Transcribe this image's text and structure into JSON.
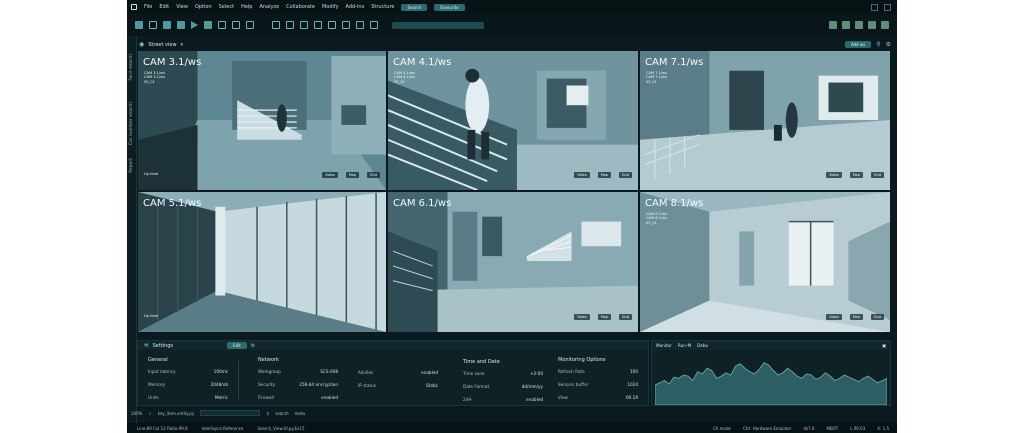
{
  "menu": [
    "File",
    "Edit",
    "View",
    "Option",
    "Select",
    "Help",
    "Analyze",
    "Collaborate",
    "Modify",
    "Add-ins",
    "Structure"
  ],
  "menu_pills": [
    "Search",
    "Favourite"
  ],
  "view_title": "Street view",
  "add_button": "Add ws",
  "sidebar_tabs": [
    "Face search",
    "Car number search",
    "Report"
  ],
  "cameras": [
    {
      "title": "CAM 3.1/ws",
      "info": [
        "CAM 3.1/ws",
        "CAM 3.1/ws",
        "05_01"
      ],
      "live": "Up time",
      "controls": [
        "Video",
        "Map",
        "Grid"
      ]
    },
    {
      "title": "CAM 4.1/ws",
      "info": [
        "CAM 4.1/ws",
        "CAM 4.1/ws",
        "05_01"
      ],
      "live": "",
      "controls": [
        "Video",
        "Map",
        "Grid"
      ]
    },
    {
      "title": "CAM 7.1/ws",
      "info": [
        "CAM 7.1/ws",
        "CAM 7.1/ws",
        "05_01"
      ],
      "live": "",
      "controls": [
        "Video",
        "Map",
        "Grid"
      ]
    },
    {
      "title": "CAM 5.1/ws",
      "info": [],
      "live": "Up time",
      "controls": []
    },
    {
      "title": "CAM 6.1/ws",
      "info": [],
      "live": "",
      "controls": [
        "Video",
        "Map",
        "Grid"
      ]
    },
    {
      "title": "CAM 8.1/ws",
      "info": [
        "CAM 8.1/ws",
        "CAM 8.1/ws",
        "05_01"
      ],
      "live": "",
      "controls": [
        "Video",
        "Map",
        "Grid"
      ]
    }
  ],
  "settings": {
    "title": "Settings",
    "badge": "Edit",
    "general": {
      "title": "General",
      "rows": [
        [
          "Input latency",
          "100ms"
        ],
        [
          "Memory",
          "2048mb"
        ],
        [
          "Units",
          "Metric"
        ]
      ]
    },
    "network": {
      "title": "Network",
      "rows": [
        [
          "Workgroup",
          "SCS-008"
        ],
        [
          "Security",
          "256-bit encryption"
        ],
        [
          "Firewall",
          "enabled"
        ]
      ]
    },
    "network2": {
      "rows": [
        [
          "AdvSec",
          "enabled"
        ],
        [
          "IP status",
          "Static"
        ]
      ]
    },
    "time": {
      "title": "Time and Date",
      "rows": [
        [
          "Time zone",
          "+2:00"
        ],
        [
          "Date Format",
          "dd/mm/yy"
        ],
        [
          "24H",
          "enabled"
        ]
      ]
    },
    "monitoring": {
      "title": "Monitoring Options",
      "rows": [
        [
          "Refresh Rate",
          "100"
        ],
        [
          "Sensors buffer",
          "1024"
        ],
        [
          "View",
          "00.19"
        ]
      ]
    }
  },
  "monitor_tabs": [
    "Monitor",
    "Run-M",
    "Debu"
  ],
  "monitor_series": [
    18,
    20,
    22,
    19,
    25,
    24,
    27,
    26,
    22,
    30,
    28,
    33,
    31,
    24,
    26,
    29,
    27,
    35,
    37,
    33,
    30,
    28,
    32,
    38,
    36,
    31,
    27,
    29,
    33,
    30,
    26,
    24,
    28,
    27,
    23,
    25,
    29,
    26,
    22,
    24,
    27,
    25,
    23,
    21,
    24,
    26,
    23,
    20,
    22,
    24
  ],
  "cmdline": {
    "zoom": "100%",
    "input": "key_item.entity.py",
    "search": "search",
    "meta": "meta"
  },
  "status": {
    "left": [
      "Line:89 Col:12 Ratio:99.6",
      "Intellisync:Reference",
      "Search_View.UI.py.Ex15"
    ],
    "right": [
      "Ch mode",
      "Ctrl: Hardware Emulator",
      "ds7.6",
      "MBOT",
      "L 06:03",
      "X: 1.5"
    ]
  }
}
